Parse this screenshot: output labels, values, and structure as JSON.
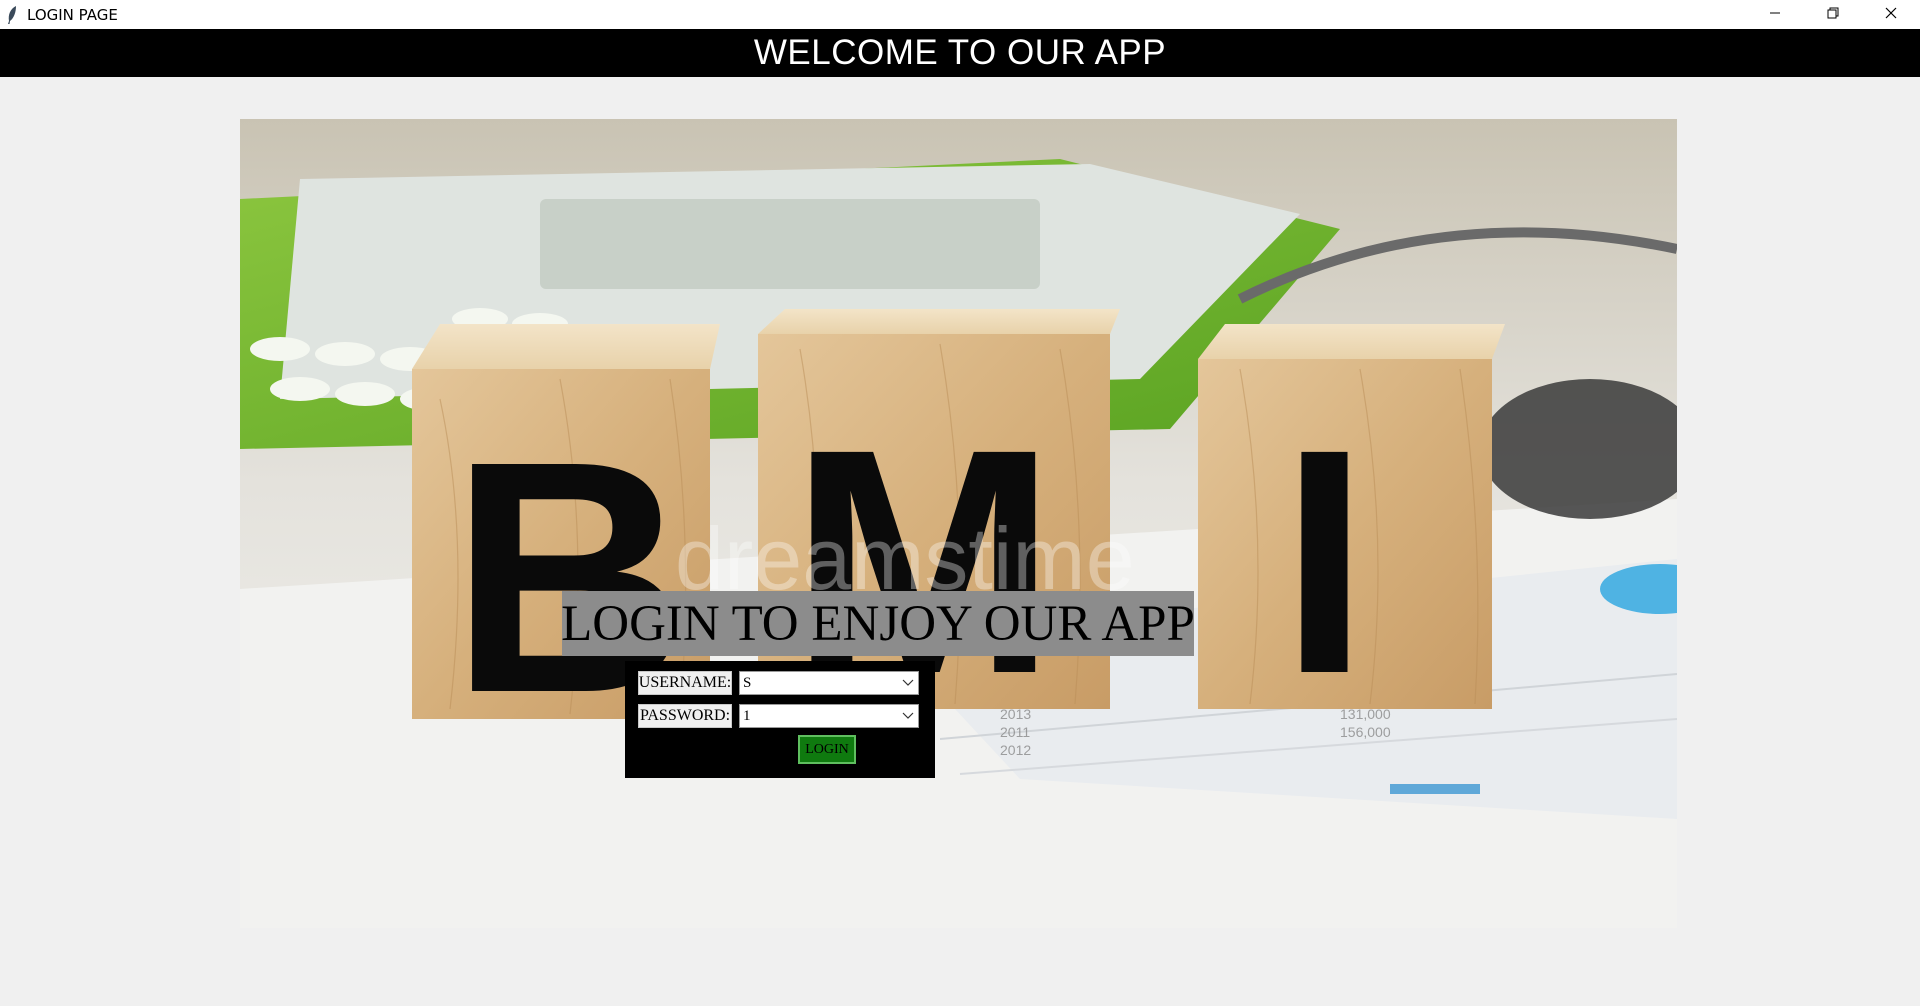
{
  "window": {
    "title": "LOGIN PAGE",
    "controls": [
      "minimize",
      "restore",
      "close"
    ]
  },
  "header": {
    "title": "WELCOME TO OUR APP"
  },
  "login": {
    "heading": "LOGIN TO ENJOY OUR APP",
    "username_label": "USERNAME:",
    "username_value": "S",
    "password_label": "PASSWORD:",
    "password_value": "1",
    "login_button": "LOGIN"
  },
  "photo": {
    "letters": [
      "B",
      "M",
      "I"
    ],
    "watermark": "dreamstime"
  },
  "colors": {
    "header_bg": "#000000",
    "header_text": "#ffffff",
    "heading_bg": "#8c8c8c",
    "panel_bg": "#000000",
    "button_bg": "#0f7a0f",
    "page_bg": "#f0f0f0"
  },
  "icons": {
    "app": "feather-icon",
    "minimize": "minimize-icon",
    "restore": "restore-icon",
    "close": "close-icon",
    "dropdown": "chevron-down-icon"
  }
}
